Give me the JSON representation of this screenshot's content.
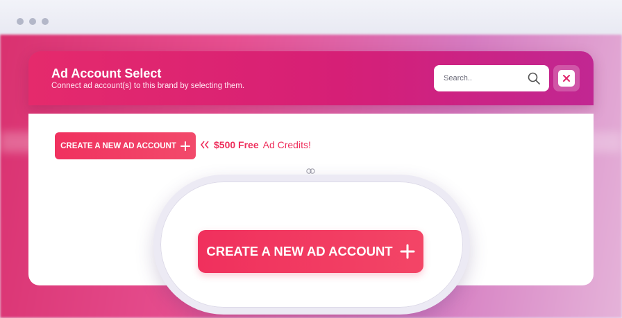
{
  "modal": {
    "title": "Ad Account Select",
    "subtitle": "Connect ad account(s) to this brand by selecting them."
  },
  "search": {
    "placeholder": "Search.."
  },
  "actions": {
    "create_label": "CREATE A NEW AD ACCOUNT",
    "credits_amount": "$500 Free",
    "credits_text": "Ad Credits!"
  },
  "colors": {
    "accent": "#f0305d",
    "header_start": "#e52a6c",
    "header_end": "#c12792"
  },
  "icons": [
    "search-icon",
    "close-icon",
    "plus-icon",
    "chevrons-left-icon"
  ]
}
